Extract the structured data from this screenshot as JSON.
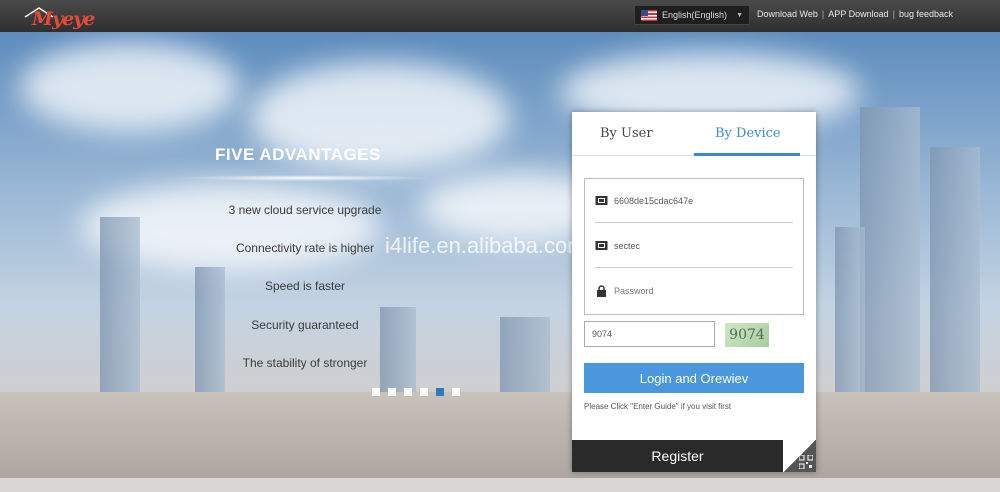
{
  "brand": {
    "logo_text": "Myeye"
  },
  "topbar": {
    "language": "English(English)",
    "links": [
      "Download Web",
      "APP Download",
      "bug feedback"
    ],
    "separator": "|"
  },
  "advantages": {
    "title": "FIVE ADVANTAGES",
    "items": [
      "3 new cloud service upgrade",
      "Connectivity rate is higher",
      "Speed is faster",
      "Security guaranteed",
      "The stability of stronger"
    ],
    "slide_count": 6,
    "active_slide": 5
  },
  "watermark": "i4life.en.alibaba.com",
  "login": {
    "tabs": [
      "By User",
      "By Device"
    ],
    "active_tab": "By Device",
    "device_id": "6608de15cdac647e",
    "device_name": "sectec",
    "password_placeholder": "Password",
    "captcha_value": "9074",
    "captcha_image_text": "9074",
    "login_button": "Login and Orewiev",
    "hint": "Please Click \"Enter Guide\" if you visit first",
    "register_button": "Register"
  },
  "colors": {
    "accent": "#3a8ad6",
    "login_button": "#4a97de",
    "topbar": "#333333",
    "register_bg": "#2a2a2a",
    "logo": "#e84a3a"
  }
}
